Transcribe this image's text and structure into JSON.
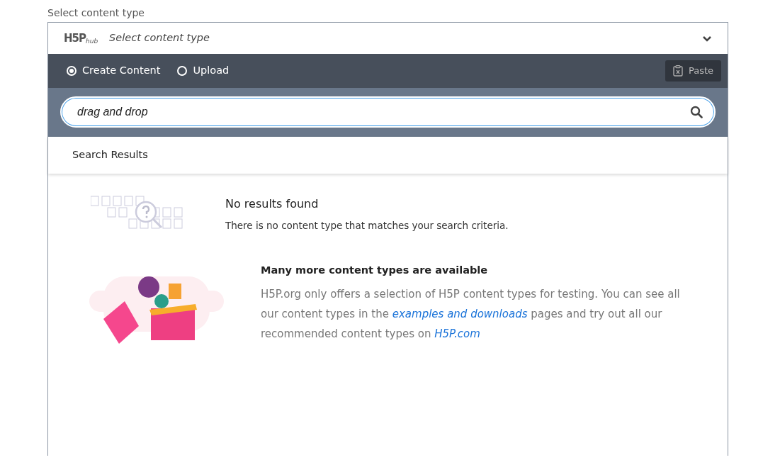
{
  "field_label": "Select content type",
  "header": {
    "logo": "H5P",
    "logo_sub": "hub",
    "title": "Select content type",
    "expanded": true
  },
  "modes": [
    {
      "label": "Create Content",
      "selected": true
    },
    {
      "label": "Upload",
      "selected": false
    }
  ],
  "paste_button": "Paste",
  "search": {
    "value": "drag and drop"
  },
  "results_tab": "Search Results",
  "no_results": {
    "title": "No results found",
    "text": "There is no content type that matches your search criteria."
  },
  "promo": {
    "title": "Many more content types are available",
    "text_before": "H5P.org only offers a selection of H5P content types for testing. You can see all our content types in the ",
    "link1": "examples and downloads",
    "text_middle": " pages and try out all our recommended content types on ",
    "link2": "H5P.com"
  }
}
